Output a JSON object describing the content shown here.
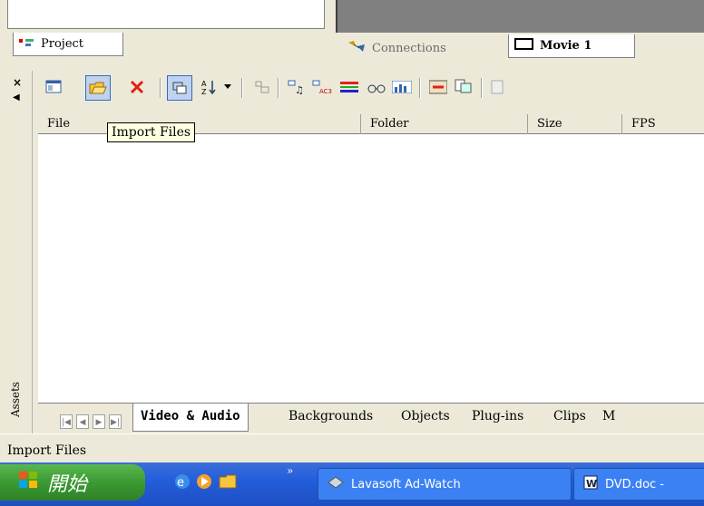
{
  "tabs_top": {
    "project": "Project",
    "connections": "Connections",
    "movie": "Movie 1"
  },
  "toolbar": {
    "tooltip": "Import Files",
    "icons": [
      "properties-icon",
      "import-files-icon",
      "delete-icon",
      "select-icon",
      "sort-icon",
      "dropdown-arrow-icon",
      "group-icon",
      "audio-icon",
      "ac3-icon",
      "timeline-icon",
      "glasses-icon",
      "chart-icon",
      "film-icon",
      "copy-icon",
      "paste-icon"
    ]
  },
  "side": {
    "close": "×",
    "assets": "Assets"
  },
  "columns": [
    "File",
    "Folder",
    "Size",
    "FPS"
  ],
  "bottom_tabs": [
    "Video & Audio",
    "Backgrounds",
    "Objects",
    "Plug-ins",
    "Clips",
    "M"
  ],
  "status": "Import Files",
  "taskbar": {
    "start": "開始",
    "tasks": [
      "Lavasoft Ad-Watch",
      "DVD.doc -"
    ],
    "more": "»"
  },
  "colors": {
    "taskbar": "#245edb",
    "start": "#3b9a33",
    "tooltip_bg": "#ffffe1"
  }
}
